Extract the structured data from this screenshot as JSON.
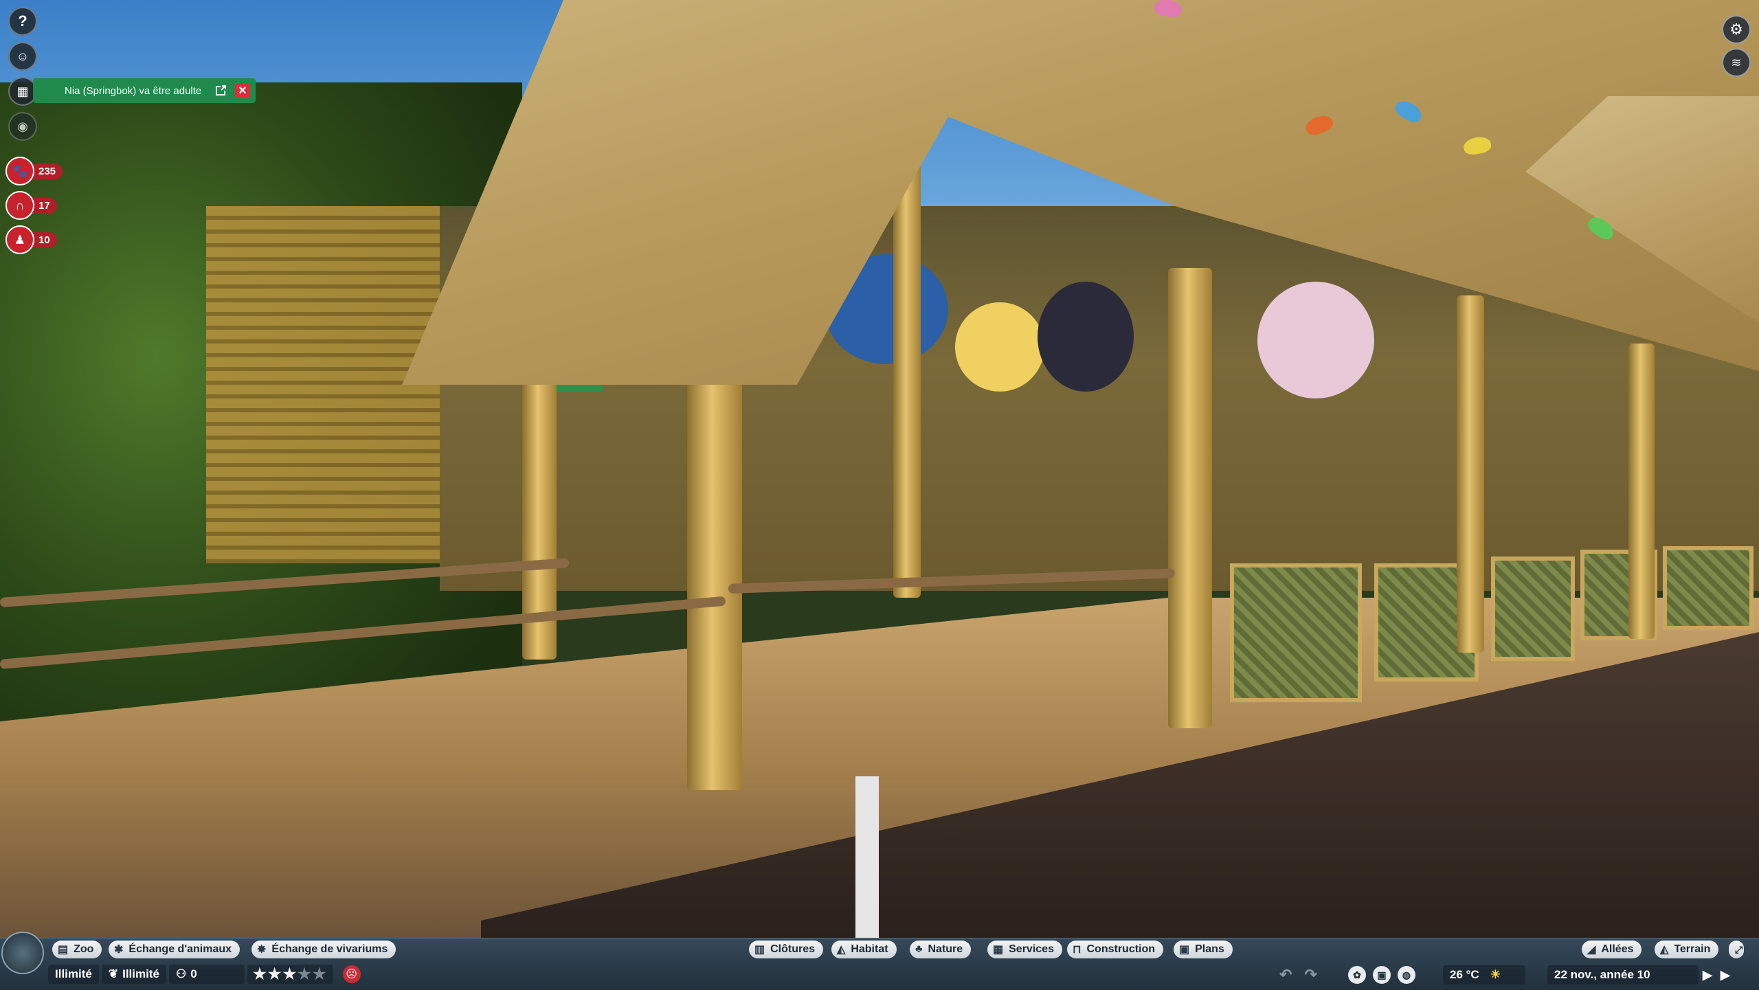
{
  "notification": {
    "text": "Nia (Springbok) va être adulte"
  },
  "stats": {
    "animals": "235",
    "staff": "17",
    "guests": "10"
  },
  "toolbar": {
    "left": [
      {
        "label": "Zoo",
        "icon": "zoo-icon"
      },
      {
        "label": "Échange d'animaux",
        "icon": "paw-icon"
      },
      {
        "label": "Échange de vivariums",
        "icon": "bug-icon"
      }
    ],
    "center": [
      {
        "label": "Clôtures",
        "icon": "fence-icon"
      },
      {
        "label": "Habitat",
        "icon": "habitat-icon"
      },
      {
        "label": "Nature",
        "icon": "tree-icon"
      },
      {
        "label": "Services",
        "icon": "building-icon"
      },
      {
        "label": "Construction",
        "icon": "construction-icon"
      },
      {
        "label": "Plans",
        "icon": "blueprint-icon"
      }
    ],
    "right": [
      {
        "label": "Allées",
        "icon": "path-icon"
      },
      {
        "label": "Terrain",
        "icon": "terrain-icon"
      }
    ]
  },
  "status": {
    "money": "Illimité",
    "research": "Illimité",
    "guests_count": "0",
    "rating_stars": 3,
    "rating_max": 5,
    "temperature": "26 °C",
    "date": "22 nov., année 10"
  },
  "colors": {
    "notification_green": "#1f8a4c",
    "alert_red": "#c8222c"
  }
}
